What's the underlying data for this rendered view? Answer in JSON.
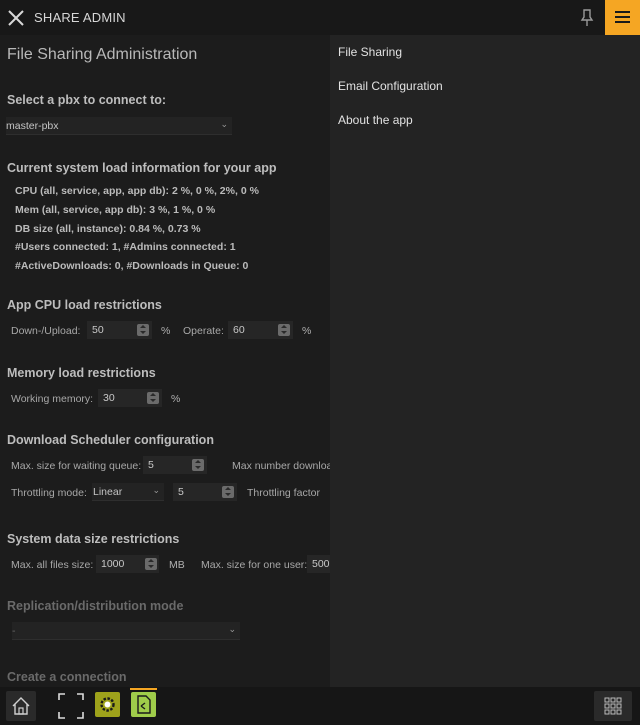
{
  "header": {
    "title": "SHARE ADMIN",
    "icons": [
      "close-icon",
      "pin-icon",
      "hamburger-menu-icon"
    ],
    "accent_color": "#f5a623"
  },
  "main": {
    "title": "File Sharing Administration",
    "pbx": {
      "label": "Select a pbx to connect to:",
      "value": "master-pbx"
    },
    "system_load": {
      "heading": "Current system load information for your app",
      "lines": [
        "CPU (all, service, app, app db): 2 %, 0 %, 2%, 0 %",
        "Mem (all, service, app db): 3 %, 1 %, 0 %",
        "DB size (all, instance): 0.84 %, 0.73 %",
        "#Users connected: 1, #Admins connected: 1",
        "#ActiveDownloads: 0, #Downloads in Queue: 0"
      ]
    },
    "cpu_restrictions": {
      "heading": "App CPU load restrictions",
      "down_upload_label": "Down-/Upload:",
      "down_upload_value": "50",
      "down_upload_unit": "%",
      "operate_label": "Operate:",
      "operate_value": "60",
      "operate_unit": "%"
    },
    "memory_restrictions": {
      "heading": "Memory load restrictions",
      "working_memory_label": "Working memory:",
      "working_memory_value": "30",
      "working_memory_unit": "%"
    },
    "scheduler": {
      "heading": "Download Scheduler configuration",
      "max_queue_label": "Max. size for waiting queue:",
      "max_queue_value": "5",
      "max_downloads_label": "Max number downloa",
      "throttling_mode_label": "Throttling mode:",
      "throttling_mode_value": "Linear",
      "throttling_value": "5",
      "throttling_factor_label": "Throttling factor"
    },
    "data_size": {
      "heading": "System data size restrictions",
      "max_all_label": "Max. all files size:",
      "max_all_value": "1000",
      "max_all_unit": "MB",
      "max_user_label": "Max. size for one user:",
      "max_user_value": "500"
    },
    "replication": {
      "heading": "Replication/distribution mode",
      "value": "-"
    },
    "connection": {
      "heading": "Create a connection"
    }
  },
  "side_menu": {
    "items": [
      "File Sharing",
      "Email Configuration",
      "About the app"
    ]
  },
  "taskbar": {
    "icons": [
      "home-icon",
      "expand-icon",
      "gear-app-icon",
      "share-app-icon",
      "grid-icon"
    ]
  }
}
